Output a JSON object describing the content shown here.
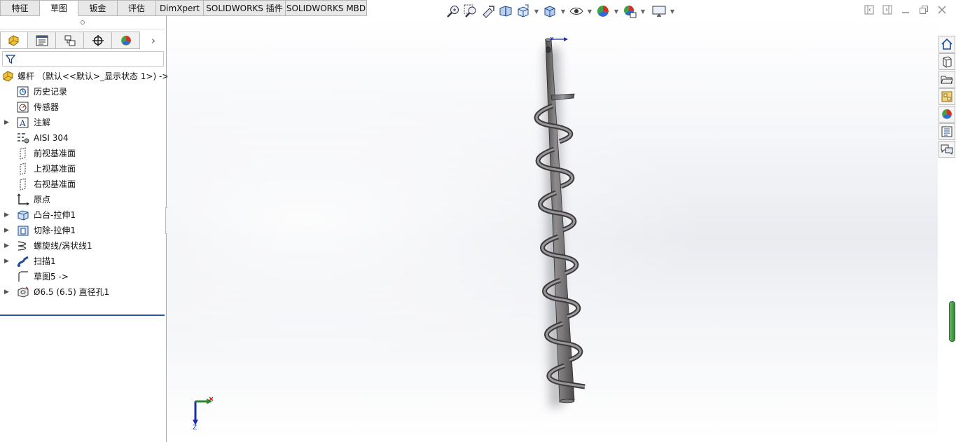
{
  "command_tabs": [
    {
      "label": "特征",
      "active": false
    },
    {
      "label": "草图",
      "active": true
    },
    {
      "label": "钣金",
      "active": false
    },
    {
      "label": "评估",
      "active": false
    },
    {
      "label": "DimXpert",
      "active": false
    },
    {
      "label": "SOLIDWORKS 插件",
      "active": false
    },
    {
      "label": "SOLIDWORKS MBD",
      "active": false
    }
  ],
  "manager_tabs": [
    {
      "name": "featuremanager-icon"
    },
    {
      "name": "propertymanager-icon"
    },
    {
      "name": "configurationmanager-icon"
    },
    {
      "name": "dimxpertmanager-icon"
    },
    {
      "name": "displaymanager-icon"
    }
  ],
  "more_label": "›",
  "feature_tree": {
    "root": {
      "label": "螺杆 （默认<<默认>_显示状态 1>) ->"
    },
    "items": [
      {
        "label": "历史记录",
        "icon": "history-icon",
        "expandable": false
      },
      {
        "label": "传感器",
        "icon": "sensors-icon",
        "expandable": false
      },
      {
        "label": "注解",
        "icon": "annotations-icon",
        "expandable": true
      },
      {
        "label": "AISI 304",
        "icon": "material-icon",
        "expandable": false
      },
      {
        "label": "前视基准面",
        "icon": "plane-icon",
        "expandable": false
      },
      {
        "label": "上视基准面",
        "icon": "plane-icon",
        "expandable": false
      },
      {
        "label": "右视基准面",
        "icon": "plane-icon",
        "expandable": false
      },
      {
        "label": "原点",
        "icon": "origin-icon",
        "expandable": false
      },
      {
        "label": "凸台-拉伸1",
        "icon": "boss-extrude-icon",
        "expandable": true
      },
      {
        "label": "切除-拉伸1",
        "icon": "cut-extrude-icon",
        "expandable": true
      },
      {
        "label": "螺旋线/涡状线1",
        "icon": "helix-icon",
        "expandable": true
      },
      {
        "label": "扫描1",
        "icon": "sweep-icon",
        "expandable": true
      },
      {
        "label": "草图5 ->",
        "icon": "sketch-icon",
        "expandable": false
      },
      {
        "label": "Ø6.5 (6.5) 直径孔1",
        "icon": "hole-icon",
        "expandable": true
      }
    ]
  },
  "heads_up_toolbar": [
    {
      "name": "zoom-to-fit-icon"
    },
    {
      "name": "zoom-to-area-icon"
    },
    {
      "name": "previous-view-icon"
    },
    {
      "name": "section-view-icon"
    },
    {
      "name": "view-orientation-icon",
      "dropdown": true
    },
    {
      "name": "display-style-icon",
      "dropdown": true
    },
    {
      "name": "hide-show-items-icon",
      "dropdown": true
    },
    {
      "name": "edit-appearance-icon",
      "dropdown": true
    },
    {
      "name": "apply-scene-icon",
      "dropdown": true
    },
    {
      "name": "view-settings-icon",
      "dropdown": true
    }
  ],
  "task_pane": [
    {
      "name": "solidworks-resources-icon"
    },
    {
      "name": "design-library-icon"
    },
    {
      "name": "file-explorer-icon"
    },
    {
      "name": "view-palette-icon"
    },
    {
      "name": "appearances-scenes-icon"
    },
    {
      "name": "custom-properties-icon"
    },
    {
      "name": "solidworks-forum-icon"
    }
  ],
  "triad": {
    "z_label": "Z"
  },
  "colors": {
    "selection_blue": "#2857a4",
    "tab_border": "#b7b7b7",
    "model_gray": "#6d6a6c"
  }
}
